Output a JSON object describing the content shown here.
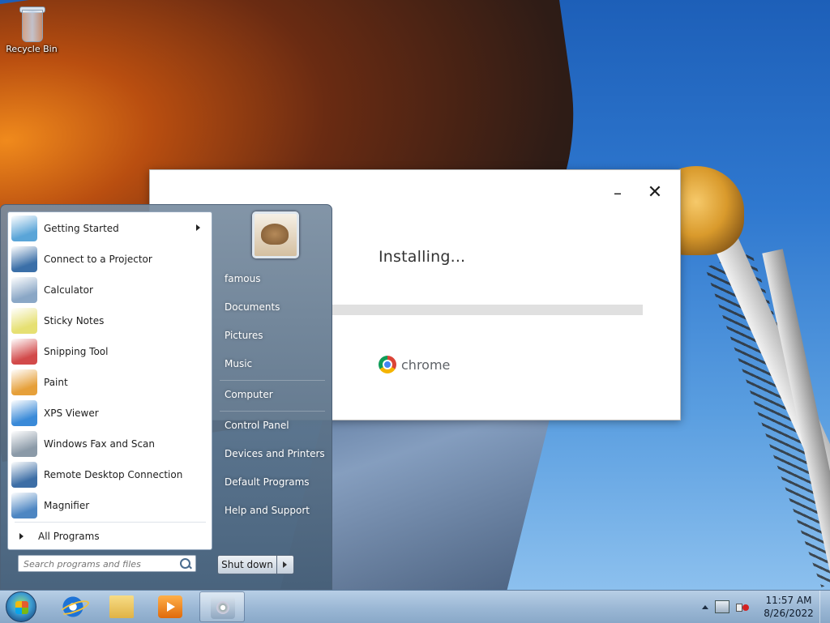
{
  "desktop": {
    "icons": [
      {
        "label": "Recycle Bin",
        "icon": "recycle-bin-icon"
      }
    ]
  },
  "installer": {
    "status": "Installing...",
    "progress": 0,
    "brand": "chrome",
    "icon": "chrome-icon"
  },
  "start_menu": {
    "programs": [
      {
        "label": "Getting Started",
        "icon": "getting-started-icon",
        "submenu": true,
        "color": "#5aa5d8"
      },
      {
        "label": "Connect to a Projector",
        "icon": "projector-icon",
        "color": "#3b6fa8"
      },
      {
        "label": "Calculator",
        "icon": "calculator-icon",
        "color": "#8aa7c6"
      },
      {
        "label": "Sticky Notes",
        "icon": "sticky-notes-icon",
        "color": "#e6e072"
      },
      {
        "label": "Snipping Tool",
        "icon": "scissors-icon",
        "color": "#d24a4a"
      },
      {
        "label": "Paint",
        "icon": "paint-icon",
        "color": "#e6a03a"
      },
      {
        "label": "XPS Viewer",
        "icon": "xps-viewer-icon",
        "color": "#3a8ad8"
      },
      {
        "label": "Windows Fax and Scan",
        "icon": "fax-scan-icon",
        "color": "#8b9aa8"
      },
      {
        "label": "Remote Desktop Connection",
        "icon": "remote-desktop-icon",
        "color": "#3d6ea6"
      },
      {
        "label": "Magnifier",
        "icon": "magnifier-icon",
        "color": "#4d86c2"
      }
    ],
    "all_programs": "All Programs",
    "search_placeholder": "Search programs and files",
    "user": "famous",
    "right_links": [
      "Documents",
      "Pictures",
      "Music",
      "Computer",
      "Control Panel",
      "Devices and Printers",
      "Default Programs",
      "Help and Support"
    ],
    "shutdown": "Shut down"
  },
  "taskbar": {
    "pinned": [
      {
        "icon": "internet-explorer-icon"
      },
      {
        "icon": "windows-explorer-icon"
      },
      {
        "icon": "media-player-icon"
      },
      {
        "icon": "setup-icon",
        "active": true
      }
    ],
    "clock": {
      "time": "11:57 AM",
      "date": "8/26/2022"
    }
  }
}
